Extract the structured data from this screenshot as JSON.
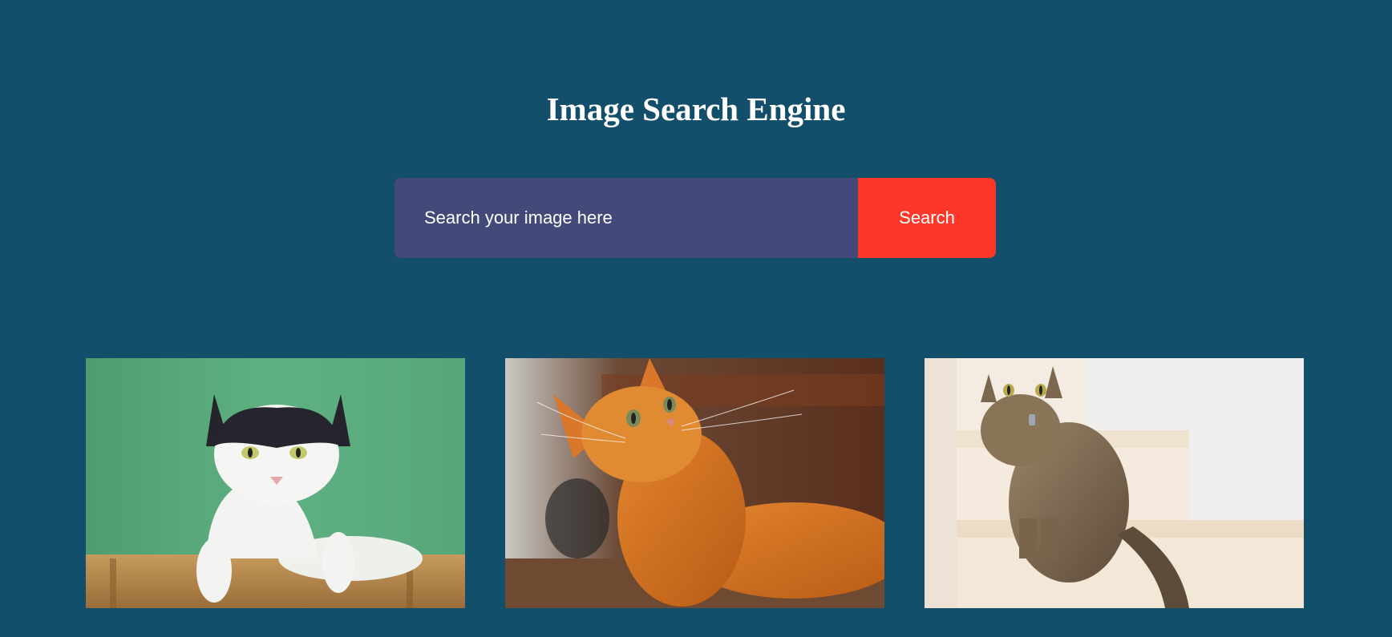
{
  "header": {
    "title": "Image Search Engine"
  },
  "search": {
    "placeholder": "Search your image here",
    "value": "",
    "button_label": "Search"
  },
  "results": [
    {
      "subject": "black and white cat on green background",
      "icon": "cat-photo-1"
    },
    {
      "subject": "orange tabby cat looking up",
      "icon": "cat-photo-2"
    },
    {
      "subject": "tabby cat sitting on stairs",
      "icon": "cat-photo-3"
    }
  ],
  "colors": {
    "background": "#134f6b",
    "input_bg": "#434978",
    "button_bg": "#fe3829",
    "text": "#ffffff"
  }
}
